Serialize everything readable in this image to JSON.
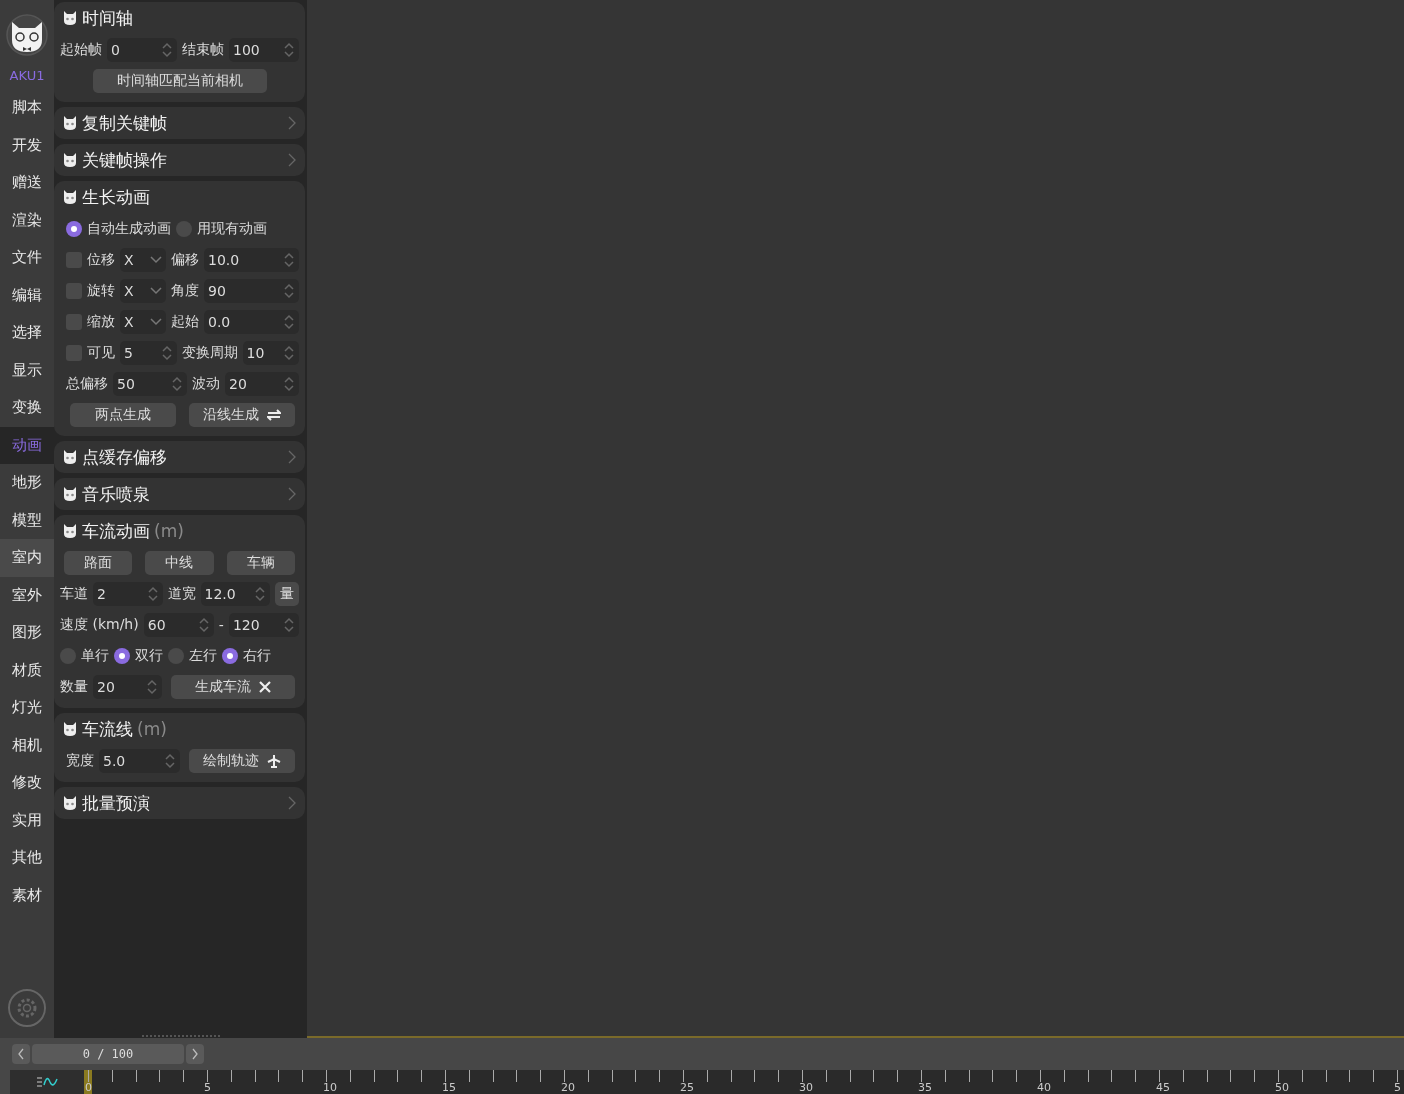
{
  "sidebar": {
    "brand": "AKU1",
    "items": [
      {
        "label": "脚本",
        "selected": false,
        "hovered": false
      },
      {
        "label": "开发",
        "selected": false,
        "hovered": false
      },
      {
        "label": "赠送",
        "selected": false,
        "hovered": false
      },
      {
        "label": "渲染",
        "selected": false,
        "hovered": false
      },
      {
        "label": "文件",
        "selected": false,
        "hovered": false
      },
      {
        "label": "编辑",
        "selected": false,
        "hovered": false
      },
      {
        "label": "选择",
        "selected": false,
        "hovered": false
      },
      {
        "label": "显示",
        "selected": false,
        "hovered": false
      },
      {
        "label": "变换",
        "selected": false,
        "hovered": false
      },
      {
        "label": "动画",
        "selected": true,
        "hovered": false
      },
      {
        "label": "地形",
        "selected": false,
        "hovered": false
      },
      {
        "label": "模型",
        "selected": false,
        "hovered": false
      },
      {
        "label": "室内",
        "selected": false,
        "hovered": true
      },
      {
        "label": "室外",
        "selected": false,
        "hovered": false
      },
      {
        "label": "图形",
        "selected": false,
        "hovered": false
      },
      {
        "label": "材质",
        "selected": false,
        "hovered": false
      },
      {
        "label": "灯光",
        "selected": false,
        "hovered": false
      },
      {
        "label": "相机",
        "selected": false,
        "hovered": false
      },
      {
        "label": "修改",
        "selected": false,
        "hovered": false
      },
      {
        "label": "实用",
        "selected": false,
        "hovered": false
      },
      {
        "label": "其他",
        "selected": false,
        "hovered": false
      },
      {
        "label": "素材",
        "selected": false,
        "hovered": false
      }
    ]
  },
  "panels": [
    {
      "title": "时间轴",
      "expanded": true,
      "rows": [
        [
          {
            "kind": "label",
            "text": "起始帧"
          },
          {
            "kind": "spin",
            "value": "0"
          },
          {
            "kind": "label",
            "text": "结束帧"
          },
          {
            "kind": "spin",
            "value": "100"
          }
        ]
      ],
      "footer_button": "时间轴匹配当前相机"
    },
    {
      "title": "复制关键帧",
      "expanded": false
    },
    {
      "title": "关键帧操作",
      "expanded": false
    },
    {
      "title": "生长动画",
      "expanded": true,
      "rows": [
        [
          {
            "kind": "radio",
            "label": "自动生成动画",
            "selected": true
          },
          {
            "kind": "radio",
            "label": "用现有动画",
            "selected": false
          }
        ],
        [
          {
            "kind": "checkbox",
            "label": "位移",
            "checked": false
          },
          {
            "kind": "dropdown",
            "value": "X"
          },
          {
            "kind": "label",
            "text": "偏移"
          },
          {
            "kind": "spin",
            "value": "10.0"
          }
        ],
        [
          {
            "kind": "checkbox",
            "label": "旋转",
            "checked": false
          },
          {
            "kind": "dropdown",
            "value": "X"
          },
          {
            "kind": "label",
            "text": "角度"
          },
          {
            "kind": "spin",
            "value": "90"
          }
        ],
        [
          {
            "kind": "checkbox",
            "label": "缩放",
            "checked": false
          },
          {
            "kind": "dropdown",
            "value": "X"
          },
          {
            "kind": "label",
            "text": "起始"
          },
          {
            "kind": "spin",
            "value": "0.0"
          }
        ],
        [
          {
            "kind": "checkbox",
            "label": "可见",
            "checked": false
          },
          {
            "kind": "spin",
            "value": "5"
          },
          {
            "kind": "label",
            "text": "变换周期"
          },
          {
            "kind": "spin",
            "value": "10"
          }
        ],
        [
          {
            "kind": "label",
            "text": "总偏移"
          },
          {
            "kind": "spin",
            "value": "50"
          },
          {
            "kind": "label",
            "text": "波动"
          },
          {
            "kind": "spin",
            "value": "20"
          }
        ],
        [
          {
            "kind": "button",
            "label": "两点生成"
          },
          {
            "kind": "swap-button",
            "label": "沿线生成"
          }
        ]
      ]
    },
    {
      "title": "点缓存偏移",
      "expanded": false
    },
    {
      "title": "音乐喷泉",
      "expanded": false
    },
    {
      "title": "车流动画",
      "suffix": "(m)",
      "expanded": true,
      "rows": [
        [
          {
            "kind": "button",
            "label": "路面"
          },
          {
            "kind": "button",
            "label": "中线"
          },
          {
            "kind": "button",
            "label": "车辆"
          }
        ],
        [
          {
            "kind": "label",
            "text": "车道"
          },
          {
            "kind": "spin",
            "value": "2"
          },
          {
            "kind": "label",
            "text": "道宽"
          },
          {
            "kind": "spin",
            "value": "12.0"
          },
          {
            "kind": "small-button",
            "label": "量"
          }
        ],
        [
          {
            "kind": "label",
            "text": "速度 (km/h)"
          },
          {
            "kind": "spin",
            "value": "60"
          },
          {
            "kind": "label",
            "text": "-"
          },
          {
            "kind": "spin",
            "value": "120"
          }
        ],
        [
          {
            "kind": "radio",
            "label": "单行",
            "selected": false
          },
          {
            "kind": "radio",
            "label": "双行",
            "selected": true
          },
          {
            "kind": "radio",
            "label": "左行",
            "selected": false
          },
          {
            "kind": "radio",
            "label": "右行",
            "selected": true
          }
        ],
        [
          {
            "kind": "label",
            "text": "数量"
          },
          {
            "kind": "spin",
            "value": "20"
          },
          {
            "kind": "close-button",
            "label": "生成车流"
          }
        ]
      ]
    },
    {
      "title": "车流线",
      "suffix": "(m)",
      "expanded": true,
      "rows": [
        [
          {
            "kind": "label",
            "text": "宽度"
          },
          {
            "kind": "spin",
            "value": "5.0"
          },
          {
            "kind": "plane-button",
            "label": "绘制轨迹"
          }
        ]
      ]
    },
    {
      "title": "批量预演",
      "expanded": false
    }
  ],
  "timeline": {
    "frame": "0 / 100",
    "ruler": [
      "0",
      "5",
      "10",
      "15",
      "20",
      "25",
      "30",
      "35",
      "40",
      "45",
      "50",
      "5"
    ]
  }
}
